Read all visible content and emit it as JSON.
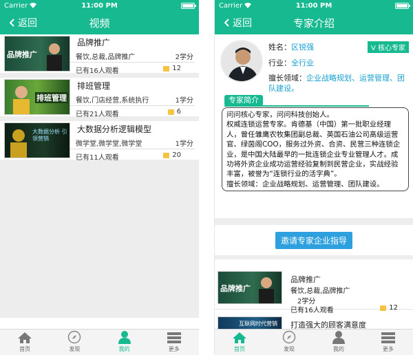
{
  "colors": {
    "accent": "#17b990",
    "link": "#17a0d0",
    "button": "#2ea0de",
    "folder": "#f5c242"
  },
  "statusbar": {
    "carrier": "Carrier",
    "time": "11:00 PM"
  },
  "left": {
    "nav": {
      "back": "返回",
      "title": "视频"
    },
    "videos": [
      {
        "thumb_text": "品牌推广",
        "title": "品牌推广",
        "tags": "餐饮,总裁,品牌推广",
        "credit": "2学分",
        "views": "已有16人观看",
        "count": "12"
      },
      {
        "thumb_text": "排班管理",
        "title": "排班管理",
        "tags": "餐饮,门店经营,系统执行",
        "credit": "1学分",
        "views": "已有21人观看",
        "count": "6"
      },
      {
        "thumb_text": "大数据分析 引领营销",
        "title": "大数据分析逻辑模型",
        "tags": "微学堂,微学堂,微学堂",
        "credit": "1学分",
        "views": "已有11人观看",
        "count": "20"
      }
    ]
  },
  "right": {
    "nav": {
      "back": "返回",
      "title": "专家介绍"
    },
    "profile": {
      "name_label": "姓名：",
      "name": "区锐强",
      "badge": "V 核心专家",
      "industry_label": "行业：",
      "industry": "全行业",
      "expertise_label": "擅长领域：",
      "expertise": "企业战略规划、运营管理、团队建设。"
    },
    "intro_title": "专家简介",
    "intro_text": "问问核心专家，问问科技创始人。\n权威连锁运营专家。肯德基（中国）第一批职业经理人，曾任雏鹰农牧集团副总裁、英国石油公司高级运营官、绿茵阁COO，服务过外资、合资、民营三种连锁企业，是中国大陆最早的一批连锁企业专业管理人才。成功将外资企业成功运营经验复制到民营企业，实战经验丰富，被誉为“连锁行业的活字典”。\n擅长领域：企业战略规划、运营管理、团队建设。",
    "invite_button": "邀请专家企业指导",
    "videos": [
      {
        "thumb_text": "品牌推广",
        "title": "品牌推广",
        "tags": "餐饮,总裁,品牌推广",
        "credit": "2学分",
        "views": "已有16人观看",
        "count": "12"
      },
      {
        "thumb_text": "互联网时代营销",
        "title": "打造强大的顾客满意度"
      }
    ]
  },
  "tabs": [
    {
      "label": "首页",
      "icon": "home-icon"
    },
    {
      "label": "发现",
      "icon": "compass-icon"
    },
    {
      "label": "我的",
      "icon": "person-icon"
    },
    {
      "label": "更多",
      "icon": "more-icon"
    }
  ],
  "active_tab": {
    "left": "我的",
    "right": "首页"
  }
}
